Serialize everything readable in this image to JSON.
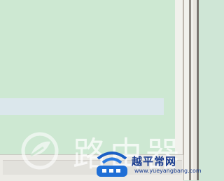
{
  "watermark": {
    "text": "路由器",
    "icon": "leaf-logo-icon"
  },
  "badge": {
    "title": "越平常网",
    "url": "www.yueyangbang.com",
    "icon": "wifi-router-icon",
    "accent": "#1a3d8f"
  },
  "colors": {
    "pane": "#cde8d2",
    "highlight_row": "#dbe7ec",
    "frame": "#f1f1ec"
  }
}
